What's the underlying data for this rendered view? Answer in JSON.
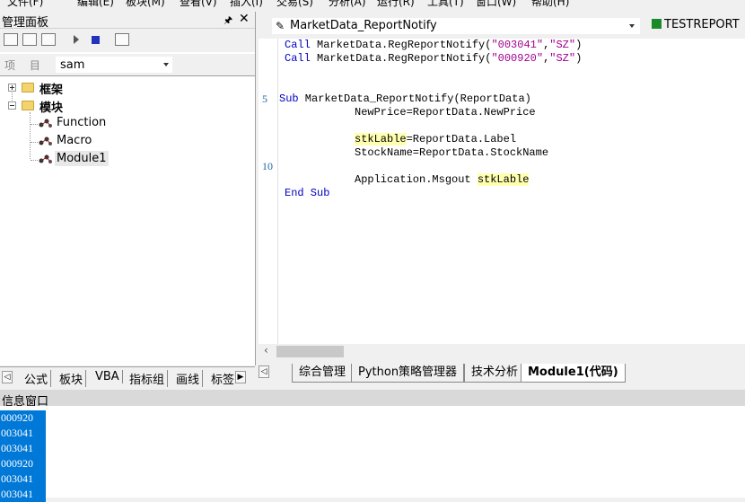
{
  "menubar": {
    "items": [
      "文件(F)",
      "编辑(E)",
      "板块(M)",
      "查看(V)",
      "插入(I)",
      "交易(S)",
      "分析(A)",
      "运行(R)",
      "工具(T)",
      "窗口(W)",
      "帮助(H)"
    ]
  },
  "left_panel": {
    "title": "管理面板",
    "project_label": "项 目",
    "project_value": "sam",
    "tree": {
      "framework": "框架",
      "modules": "模块",
      "children": [
        "Function",
        "Macro",
        "Module1"
      ]
    },
    "tabs": [
      "公式",
      "板块",
      "VBA",
      "指标组",
      "画线",
      "标签"
    ]
  },
  "editor": {
    "procedure_combo": "MarketData_ReportNotify",
    "object_label": "TESTREPORT",
    "line_numbers": [
      "5",
      "10"
    ],
    "lines": [
      {
        "kw": "Call",
        "rest": " MarketData.RegReportNotify(",
        "s1": "\"003041\"",
        "sep": ",",
        "s2": "\"SZ\"",
        "end": ")"
      },
      {
        "kw": "Call",
        "rest": " MarketData.RegReportNotify(",
        "s1": "\"000920\"",
        "sep": ",",
        "s2": "\"SZ\"",
        "end": ")"
      }
    ],
    "sub_kw": "Sub",
    "sub_decl": " MarketData_ReportNotify(ReportData)",
    "line_newprice": "NewPrice=ReportData.NewPrice",
    "line_stklable_var": "stkLable",
    "line_stklable_rest": "=ReportData.Label",
    "line_stockname": "StockName=ReportData.StockName",
    "line_msgout": "Application.Msgout ",
    "line_msgout_var": "stkLable",
    "end_sub": "End Sub"
  },
  "right_tabs": [
    "综合管理",
    "Python策略管理器",
    "技术分析",
    "Module1(代码)"
  ],
  "info_window": {
    "title": "信息窗口",
    "lines": [
      "000920",
      "003041",
      "003041",
      "000920",
      "003041",
      "003041"
    ]
  }
}
